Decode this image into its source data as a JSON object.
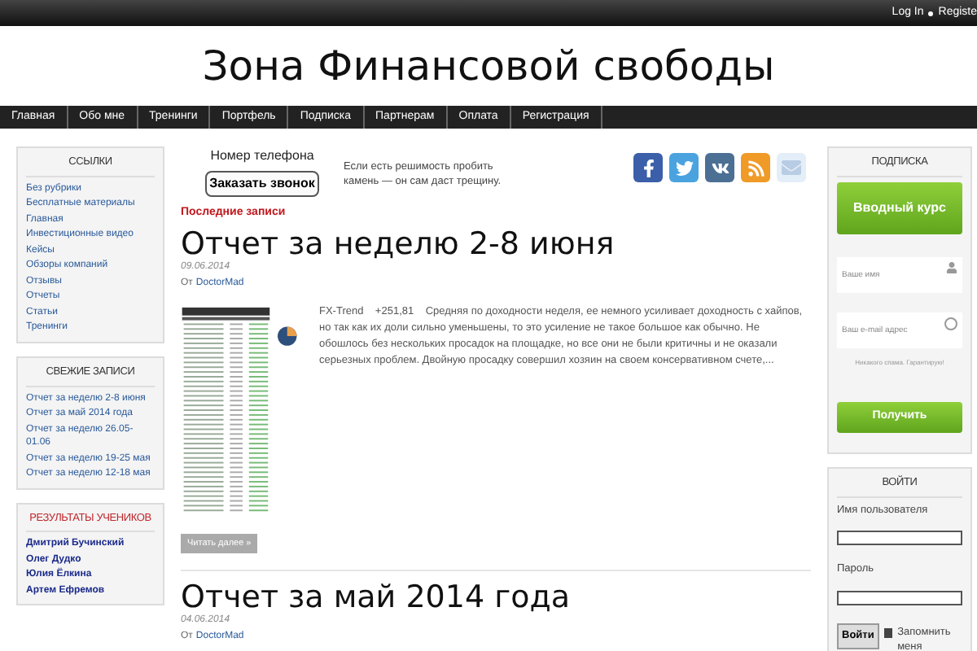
{
  "top_bar": {
    "links": [
      "Log In",
      "Registe"
    ]
  },
  "site_title": "Зона Финансовой свободы",
  "nav": {
    "items": [
      {
        "label": "Главная",
        "selected": false
      },
      {
        "label": "Обо мне",
        "selected": false
      },
      {
        "label": "Тренинги",
        "selected": false
      },
      {
        "label": "Портфель",
        "selected": false
      },
      {
        "label": "Подписка",
        "selected": false
      },
      {
        "label": "Партнерам",
        "selected": false
      },
      {
        "label": "Оплата",
        "selected": false
      },
      {
        "label": "Регистрация",
        "selected": false
      }
    ]
  },
  "left_sidebar": [
    {
      "kind": "links",
      "title": "ССЫЛКИ",
      "items": [
        "Без рубрики",
        "Бесплатные материалы",
        "Главная",
        "Инвестиционные видео",
        "Кейсы",
        "Обзоры компаний",
        "Отзывы",
        "Отчеты",
        "Статьи",
        "Тренинги"
      ]
    },
    {
      "kind": "links",
      "title": "СВЕЖИЕ ЗАПИСИ",
      "items": [
        "Отчет за неделю 2-8 июня",
        "Отчет за май 2014 года",
        "Отчет за неделю 26.05-01.06",
        "Отчет за неделю 19-25 мая",
        "Отчет за неделю 12-18 мая"
      ]
    },
    {
      "kind": "names",
      "title": "РЕЗУЛЬТАТЫ УЧЕНИКОВ",
      "items": [
        "Дмитрий Бучинский",
        "Олег Дудко",
        "Юлия Ёлкина",
        "Артем Ефремов"
      ]
    }
  ],
  "header_box": {
    "phone_label": "Номер телефона",
    "call_button": "Заказать звонок",
    "quote": "Если есть решимость пробить камень — он сам даст трещину."
  },
  "section_title": "Последние записи",
  "posts": [
    {
      "title": "Отчет за неделю 2-8 июня",
      "date": "09.06.2014",
      "by": "От",
      "author": "DoctorMad",
      "excerpt": "FX-Trend    +251,81    Средняя по доходности неделя, ее немного усиливает доходность с хайпов, но так как их доли сильно уменьшены, то это усиление не такое большое как обычно. Не обошлось без нескольких просадок на площадке, но все они не были критичны и не оказали серьезных проблем. Двойную просадку совершил хозяин на своем консервативном счете,...",
      "read_more": "Читать далее »"
    },
    {
      "title": "Отчет за май 2014 года",
      "date": "04.06.2014",
      "by": "От",
      "author": "DoctorMad"
    }
  ],
  "subscribe": {
    "title": "ПОДПИСКА",
    "course_button": "Вводный курс",
    "name_placeholder": "Ваше имя",
    "email_placeholder": "Ваш e-mail адрес",
    "note": "Никакого спама. Гарантирую!",
    "submit": "Получить"
  },
  "login": {
    "title": "ВОЙТИ",
    "username_label": "Имя пользователя",
    "password_label": "Пароль",
    "submit": "Войти",
    "remember": {
      "label": "Запомнить меня",
      "checked": true
    }
  }
}
